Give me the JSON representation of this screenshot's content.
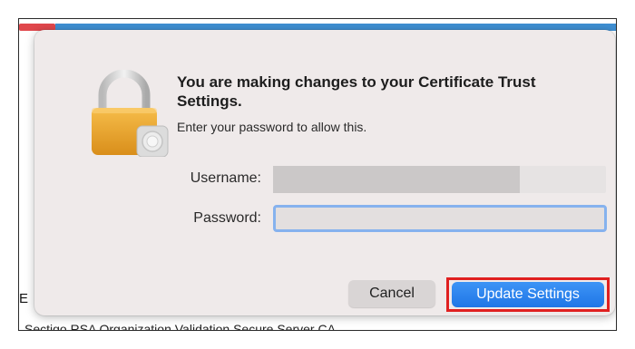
{
  "background": {
    "bottom_text": "Sectigo RSA Organization Validation Secure Server CA",
    "side_mark": "E"
  },
  "dialog": {
    "icon": "lock-icon",
    "title": "You are making changes to your Certificate Trust Settings.",
    "subtitle": "Enter your password to allow this.",
    "username_label": "Username:",
    "username_value": "",
    "password_label": "Password:",
    "password_value": "",
    "cancel_label": "Cancel",
    "update_label": "Update Settings"
  },
  "colors": {
    "accent": "#2a85f0",
    "highlight": "#e02020",
    "dialog_bg": "#efeaea"
  }
}
